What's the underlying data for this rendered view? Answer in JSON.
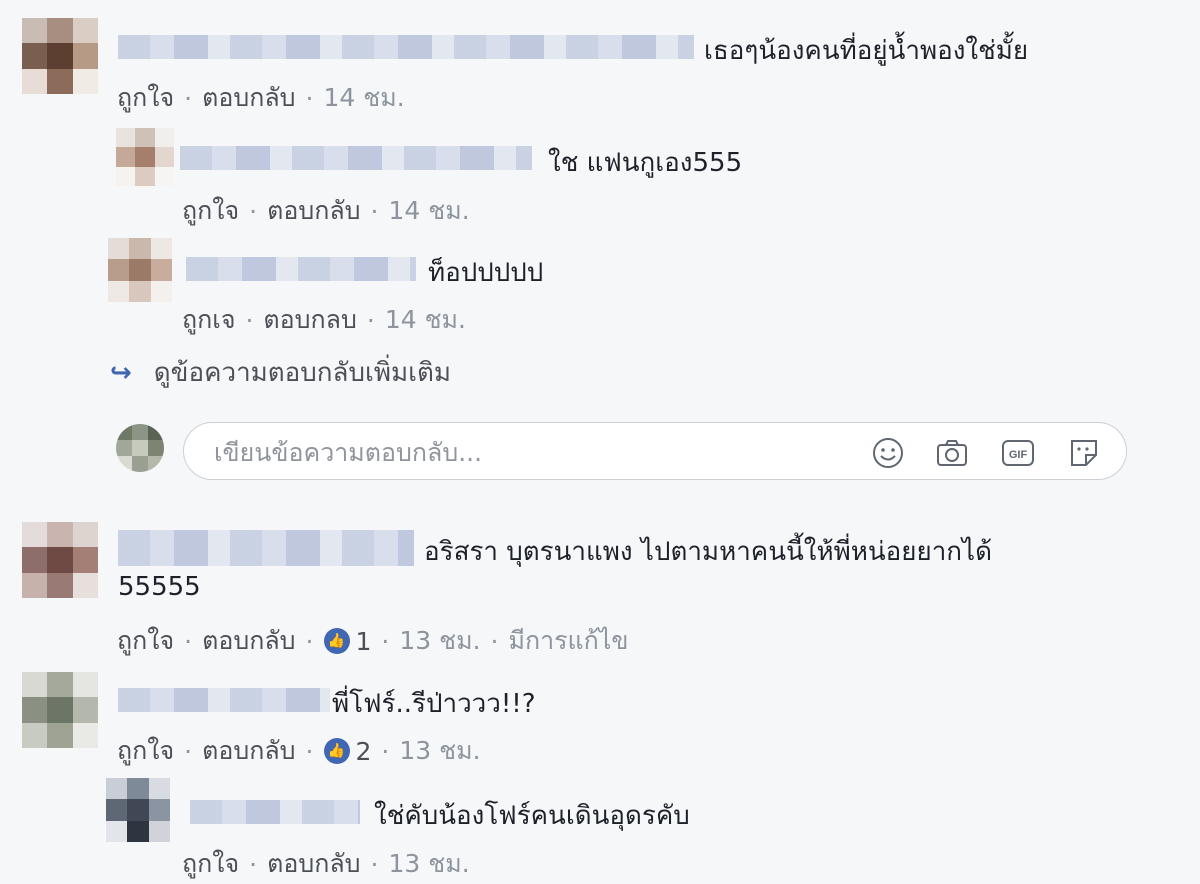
{
  "comments": [
    {
      "text": "เธอๆน้องคนที่อยู่น้ำพองใช่มั้ย",
      "actions": {
        "like": "ถูกใจ",
        "reply": "ตอบกลับ",
        "time": "14 ชม."
      }
    },
    {
      "text": "ใช แฟนกูเอง555",
      "actions": {
        "like": "ถูกใจ",
        "reply": "ตอบกลับ",
        "time": "14 ชม."
      }
    },
    {
      "text": "ท็อปปปปป",
      "actions": {
        "like": "ถูกเจ",
        "reply": "ตอบกลบ",
        "time": "14 ชม."
      }
    },
    {
      "text_line1": "อริสรา บุตรนาแพง ไปตามหาคนนี้ให้พี่หน่อยยากได้",
      "text_line2": "55555",
      "actions": {
        "like": "ถูกใจ",
        "reply": "ตอบกลับ",
        "reaction_count": "1",
        "time": "13 ชม.",
        "edited": "มีการแก้ไข"
      }
    },
    {
      "text": "พี่โฟร์..รีป่าววว!!?",
      "actions": {
        "like": "ถูกใจ",
        "reply": "ตอบกลับ",
        "reaction_count": "2",
        "time": "13 ชม."
      }
    },
    {
      "text": "ใช่คับน้องโฟร์คนเดินอุดรคับ",
      "actions": {
        "like": "ถูกใจ",
        "reply": "ตอบกลับ",
        "time": "13 ชม."
      }
    }
  ],
  "more_replies": {
    "label": "ดูข้อความตอบกลับเพิ่มเติม",
    "icon": "reply-arrow-icon"
  },
  "reply_box": {
    "placeholder": "เขียนข้อความตอบกลับ...",
    "icons": [
      "emoji-icon",
      "camera-icon",
      "gif-icon",
      "sticker-icon"
    ],
    "gif_label": "GIF"
  },
  "colors": {
    "accent": "#4267b2",
    "meta": "#8d949e",
    "background": "#f6f7f9"
  }
}
